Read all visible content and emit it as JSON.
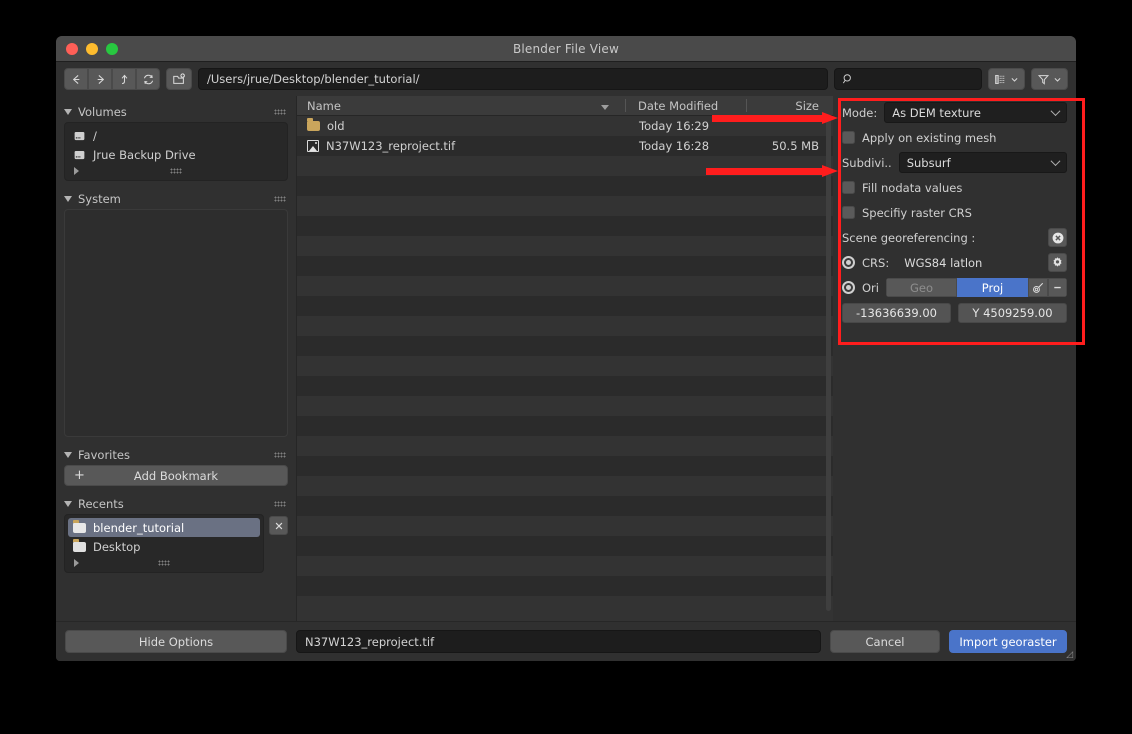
{
  "window": {
    "title": "Blender File View",
    "traffic_lights": [
      "close-red",
      "minimize-yellow",
      "maximize-green"
    ]
  },
  "toolbar": {
    "nav": [
      {
        "name": "back-button",
        "icon": "arrow-left-icon"
      },
      {
        "name": "forward-button",
        "icon": "arrow-right-icon"
      },
      {
        "name": "parent-dir-button",
        "icon": "arrow-up-icon"
      },
      {
        "name": "refresh-button",
        "icon": "refresh-icon"
      }
    ],
    "new_folder_icon": "new-folder-icon",
    "path_value": "/Users/jrue/Desktop/blender_tutorial/",
    "search_placeholder": "",
    "search_value": "",
    "search_icon": "search-icon",
    "display_mode_icon": "list-display-icon",
    "filter_icon": "filter-funnel-icon"
  },
  "sidebar": {
    "sections": [
      {
        "title": "Volumes",
        "items": [
          {
            "label": "/",
            "icon": "drive-icon"
          },
          {
            "label": "Jrue Backup Drive",
            "icon": "drive-icon"
          }
        ]
      },
      {
        "title": "System",
        "items": []
      },
      {
        "title": "Favorites",
        "add_bookmark_label": "Add Bookmark",
        "add_bookmark_icon": "plus-icon",
        "items": []
      },
      {
        "title": "Recents",
        "clear_icon": "close-x-icon",
        "items": [
          {
            "label": "blender_tutorial",
            "icon": "folder-icon",
            "selected": true
          },
          {
            "label": "Desktop",
            "icon": "folder-icon",
            "selected": false
          }
        ]
      }
    ]
  },
  "filelist": {
    "columns": [
      "Name",
      "Date Modified",
      "Size"
    ],
    "sort_indicator": "sort-descending-icon",
    "rows": [
      {
        "name": "old",
        "icon": "folder-icon",
        "date": "Today 16:29",
        "size": ""
      },
      {
        "name": "N37W123_reproject.tif",
        "icon": "image-file-icon",
        "date": "Today 16:28",
        "size": "50.5 MB"
      }
    ],
    "empty_row_count": 23
  },
  "options": {
    "mode_label": "Mode:",
    "mode_value": "As DEM texture",
    "apply_existing_mesh_label": "Apply on existing mesh",
    "apply_existing_mesh_checked": false,
    "subdivision_label": "Subdivi..",
    "subdivision_value": "Subsurf",
    "fill_nodata_label": "Fill nodata values",
    "fill_nodata_checked": false,
    "specify_crs_label": "Specifiy raster CRS",
    "specify_crs_checked": false,
    "scene_georef_title": "Scene georeferencing :",
    "scene_georef_clear_icon": "x-circle-icon",
    "crs_label": "CRS:",
    "crs_value": "WGS84 latlon",
    "crs_settings_icon": "gear-icon",
    "ori_label": "Ori",
    "ori_geo_label": "Geo",
    "ori_proj_label": "Proj",
    "ori_active": "Proj",
    "ori_pick_icon": "eyedropper-icon",
    "ori_minus_icon": "minus-icon",
    "coord_x": "-13636639.00",
    "coord_y": "Y 4509259.00",
    "accent_blue": "#4a74c9"
  },
  "footer": {
    "hide_options_label": "Hide Options",
    "filename_value": "N37W123_reproject.tif",
    "cancel_label": "Cancel",
    "import_label": "Import georaster",
    "resize_grip_icon": "resize-grip-icon"
  },
  "annotations": {
    "highlight_color": "#ff1d1d",
    "box_target": "options-panel",
    "arrows": [
      "points-to-mode-dropdown",
      "points-to-subdivision-dropdown"
    ]
  }
}
